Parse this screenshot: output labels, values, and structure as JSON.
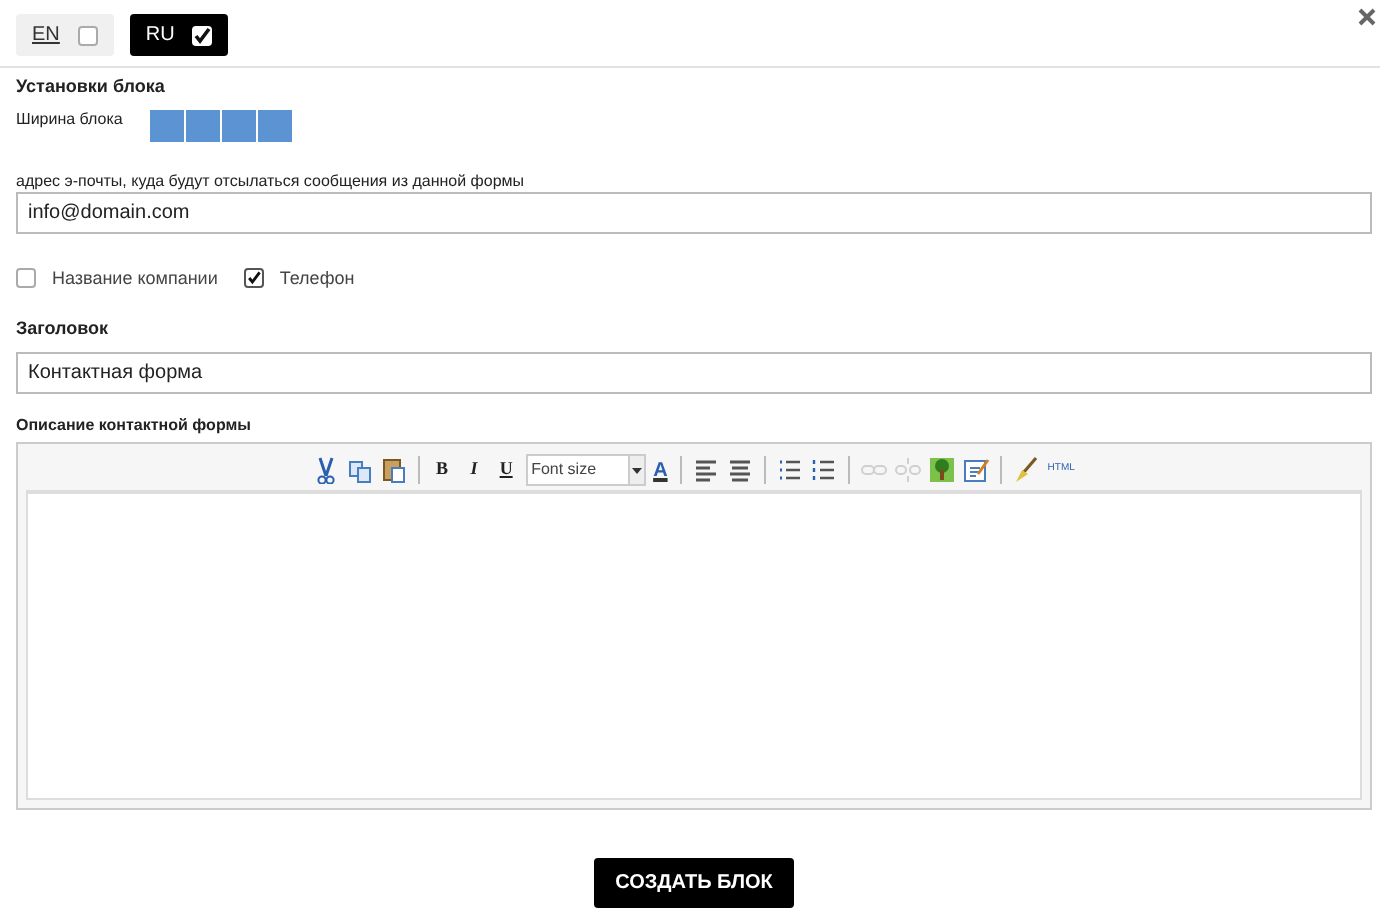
{
  "languages": [
    {
      "label": "EN",
      "selected": false,
      "checked": false
    },
    {
      "label": "RU",
      "selected": true,
      "checked": true
    }
  ],
  "block_settings": {
    "title": "Установки блока",
    "width_label": "Ширина блока",
    "width_cells": [
      {
        "selected": true
      },
      {
        "selected": true
      },
      {
        "selected": true
      },
      {
        "selected": true
      }
    ]
  },
  "email": {
    "label": "адрес э-почты, куда будут отсылаться сообщения из данной формы",
    "value": "info@domain.com"
  },
  "options": [
    {
      "label": "Название компании",
      "checked": false
    },
    {
      "label": "Телефон",
      "checked": true
    }
  ],
  "heading": {
    "label": "Заголовок",
    "value": "Контактная форма"
  },
  "description": {
    "label": "Описание контактной формы",
    "toolbar": [
      {
        "kind": "cut",
        "disabled": false
      },
      {
        "kind": "copy",
        "disabled": false
      },
      {
        "kind": "paste",
        "disabled": false
      },
      {
        "kind": "sep"
      },
      {
        "kind": "bold",
        "text": "B",
        "disabled": false
      },
      {
        "kind": "italic",
        "text": "I",
        "disabled": false
      },
      {
        "kind": "underline",
        "text": "U",
        "disabled": false
      },
      {
        "kind": "select",
        "text": "Font size"
      },
      {
        "kind": "color",
        "text": "A",
        "disabled": false
      },
      {
        "kind": "sep"
      },
      {
        "kind": "align-left",
        "disabled": false
      },
      {
        "kind": "align-center",
        "disabled": false
      },
      {
        "kind": "sep"
      },
      {
        "kind": "bullets",
        "disabled": false
      },
      {
        "kind": "numbers",
        "disabled": false
      },
      {
        "kind": "sep"
      },
      {
        "kind": "link",
        "disabled": true
      },
      {
        "kind": "unlink",
        "disabled": true
      },
      {
        "kind": "image",
        "disabled": false
      },
      {
        "kind": "edit",
        "disabled": false
      },
      {
        "kind": "sep"
      },
      {
        "kind": "clean",
        "disabled": false
      },
      {
        "kind": "html",
        "text": "HTML",
        "disabled": false
      }
    ]
  },
  "submit": "СОЗДАТЬ БЛОК"
}
